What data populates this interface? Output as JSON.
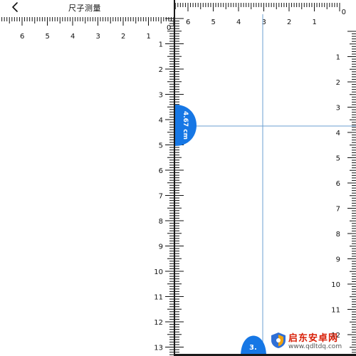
{
  "app": {
    "title": "尺子测量"
  },
  "left_ruler": {
    "top_numbers": [
      "6",
      "5",
      "4",
      "3",
      "2",
      "1"
    ],
    "right_numbers": [
      "1",
      "2",
      "3",
      "4",
      "5",
      "6",
      "7",
      "8",
      "9",
      "10",
      "11",
      "12",
      "13"
    ]
  },
  "right_ruler": {
    "origin_label": "0",
    "top_numbers": [
      "6",
      "5",
      "4",
      "3",
      "2",
      "1"
    ],
    "left_numbers": [
      "1",
      "2",
      "3",
      "4",
      "5",
      "6",
      "7",
      "8",
      "9",
      "10",
      "11",
      "12",
      "13"
    ],
    "right_numbers": [
      "1",
      "2",
      "3",
      "4",
      "5",
      "6",
      "7",
      "8",
      "9",
      "10",
      "11",
      "12"
    ]
  },
  "measurements": {
    "primary_label": "4.67 cm",
    "secondary_label": "3."
  },
  "colors": {
    "accent_blue": "#1677e5",
    "guide_line": "#6b9fd1",
    "ruler_ink": "#111111"
  },
  "watermark": {
    "title": "启东安卓网",
    "url": "www.qdltdq.com"
  },
  "icons": {
    "back": "chevron-left-icon",
    "watermark_logo": "shield-logo-icon"
  }
}
